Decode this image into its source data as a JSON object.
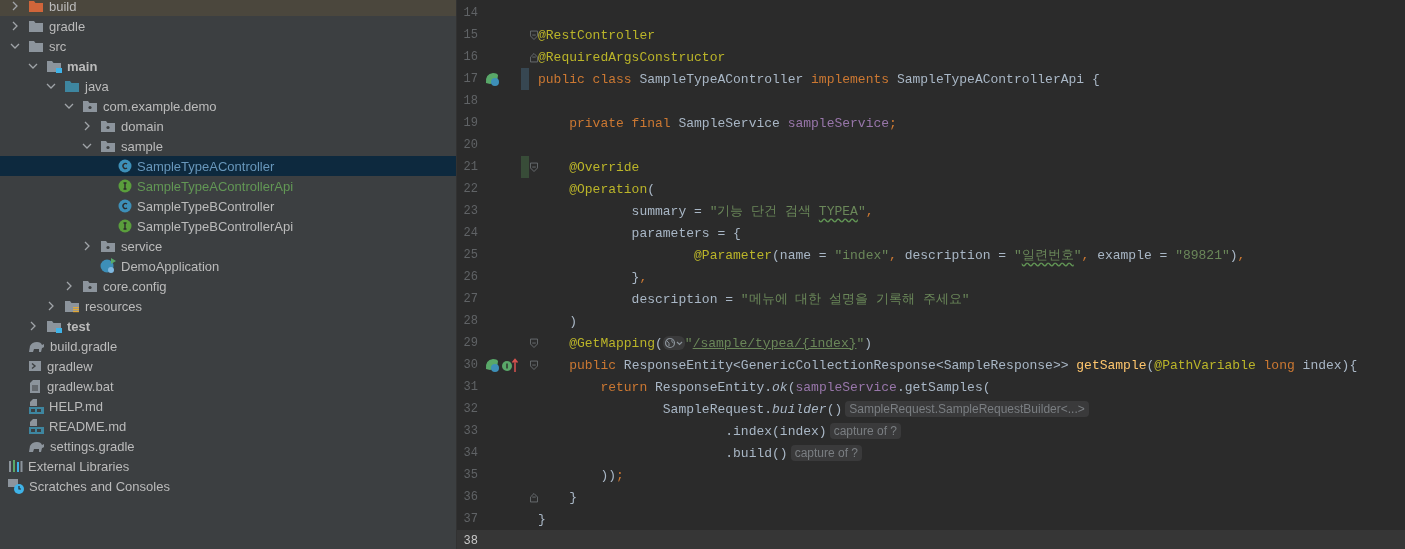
{
  "project_tree": [
    {
      "label": "build",
      "kind": "excluded-folder",
      "expanded": false,
      "selected": false,
      "modified": false,
      "added": false
    },
    {
      "label": "gradle",
      "kind": "folder",
      "expanded": false,
      "selected": false,
      "modified": false,
      "added": false
    },
    {
      "label": "src",
      "kind": "folder",
      "expanded": true,
      "selected": false,
      "modified": false,
      "added": false,
      "children": [
        {
          "label": "main",
          "kind": "module-folder",
          "expanded": true,
          "selected": false,
          "modified": false,
          "added": false,
          "children": [
            {
              "label": "java",
              "kind": "source-folder",
              "expanded": true,
              "selected": false,
              "modified": false,
              "added": false,
              "children": [
                {
                  "label": "com.example.demo",
                  "kind": "package",
                  "expanded": true,
                  "selected": false,
                  "modified": false,
                  "added": false,
                  "children": [
                    {
                      "label": "domain",
                      "kind": "package",
                      "expanded": false,
                      "selected": false,
                      "modified": false,
                      "added": false
                    },
                    {
                      "label": "sample",
                      "kind": "package",
                      "expanded": true,
                      "selected": false,
                      "modified": false,
                      "added": false,
                      "children": [
                        {
                          "label": "SampleTypeAController",
                          "kind": "class",
                          "selected": true,
                          "modified": true,
                          "added": false
                        },
                        {
                          "label": "SampleTypeAControllerApi",
                          "kind": "interface",
                          "selected": false,
                          "modified": false,
                          "added": true
                        },
                        {
                          "label": "SampleTypeBController",
                          "kind": "class",
                          "selected": false,
                          "modified": false,
                          "added": false
                        },
                        {
                          "label": "SampleTypeBControllerApi",
                          "kind": "interface",
                          "selected": false,
                          "modified": false,
                          "added": false
                        }
                      ]
                    },
                    {
                      "label": "service",
                      "kind": "package",
                      "expanded": false,
                      "selected": false,
                      "modified": false,
                      "added": false
                    },
                    {
                      "label": "DemoApplication",
                      "kind": "spring-app",
                      "selected": false,
                      "modified": false,
                      "added": false
                    }
                  ]
                },
                {
                  "label": "core.config",
                  "kind": "package",
                  "expanded": false,
                  "selected": false,
                  "modified": false,
                  "added": false
                }
              ]
            },
            {
              "label": "resources",
              "kind": "resources-folder",
              "expanded": false,
              "selected": false,
              "modified": false,
              "added": false
            }
          ]
        },
        {
          "label": "test",
          "kind": "module-folder",
          "expanded": false,
          "selected": false,
          "modified": false,
          "added": false
        }
      ]
    },
    {
      "label": "build.gradle",
      "kind": "gradle",
      "selected": false,
      "modified": false,
      "added": false
    },
    {
      "label": "gradlew",
      "kind": "script",
      "selected": false,
      "modified": false,
      "added": false
    },
    {
      "label": "gradlew.bat",
      "kind": "text",
      "selected": false,
      "modified": false,
      "added": false
    },
    {
      "label": "HELP.md",
      "kind": "markdown",
      "selected": false,
      "modified": false,
      "added": false
    },
    {
      "label": "README.md",
      "kind": "markdown",
      "selected": false,
      "modified": false,
      "added": false
    },
    {
      "label": "settings.gradle",
      "kind": "gradle",
      "selected": false,
      "modified": false,
      "added": false
    },
    {
      "label": "External Libraries",
      "kind": "libraries",
      "selected": false,
      "modified": false,
      "added": false
    },
    {
      "label": "Scratches and Consoles",
      "kind": "scratches",
      "selected": false,
      "modified": false,
      "added": false
    }
  ],
  "editor": {
    "lines": [
      {
        "number": "14",
        "current": false
      },
      {
        "number": "15",
        "current": false,
        "markers": [
          {
            "kind": "fold-start"
          }
        ],
        "tokens": [
          {
            "text": "@RestController",
            "kind": "ann"
          }
        ]
      },
      {
        "number": "16",
        "current": false,
        "markers": [
          {
            "kind": "fold-end"
          }
        ],
        "tokens": [
          {
            "text": "@RequiredArgsConstructor",
            "kind": "ann"
          }
        ]
      },
      {
        "number": "17",
        "current": false,
        "markers": [
          {
            "kind": "spring-bean"
          },
          {
            "kind": "change-modified"
          }
        ],
        "tokens": [
          {
            "text": "public class ",
            "kind": "kw"
          },
          {
            "text": "SampleTypeAController ",
            "kind": "plain"
          },
          {
            "text": "implements ",
            "kind": "kw"
          },
          {
            "text": "SampleTypeAControllerApi {",
            "kind": "plain"
          }
        ]
      },
      {
        "number": "18",
        "current": false
      },
      {
        "number": "19",
        "current": false,
        "tokens": [
          {
            "text": "    private final ",
            "kind": "kw"
          },
          {
            "text": "SampleService ",
            "kind": "plain"
          },
          {
            "text": "sampleService",
            "kind": "field"
          },
          {
            "text": ";",
            "kind": "kw"
          }
        ]
      },
      {
        "number": "20",
        "current": false
      },
      {
        "number": "21",
        "current": false,
        "markers": [
          {
            "kind": "change-added"
          },
          {
            "kind": "fold-start"
          }
        ],
        "tokens": [
          {
            "text": "    @Override",
            "kind": "ann"
          }
        ]
      },
      {
        "number": "22",
        "current": false,
        "tokens": [
          {
            "text": "    @Operation",
            "kind": "ann"
          },
          {
            "text": "(",
            "kind": "plain"
          }
        ]
      },
      {
        "number": "23",
        "current": false,
        "tokens": [
          {
            "text": "            summary = ",
            "kind": "plain"
          },
          {
            "text": "\"기능 단건 검색 ",
            "kind": "str"
          },
          {
            "text": "TYPEA",
            "kind": "str-typo"
          },
          {
            "text": "\"",
            "kind": "str"
          },
          {
            "text": ",",
            "kind": "kw"
          }
        ]
      },
      {
        "number": "24",
        "current": false,
        "tokens": [
          {
            "text": "            parameters = {",
            "kind": "plain"
          }
        ]
      },
      {
        "number": "25",
        "current": false,
        "tokens": [
          {
            "text": "                    @Parameter",
            "kind": "ann"
          },
          {
            "text": "(name = ",
            "kind": "plain"
          },
          {
            "text": "\"index\"",
            "kind": "str"
          },
          {
            "text": ", ",
            "kind": "kw"
          },
          {
            "text": "description = ",
            "kind": "plain"
          },
          {
            "text": "\"",
            "kind": "str"
          },
          {
            "text": "일련번호",
            "kind": "str-typo"
          },
          {
            "text": "\"",
            "kind": "str"
          },
          {
            "text": ", ",
            "kind": "kw"
          },
          {
            "text": "example = ",
            "kind": "plain"
          },
          {
            "text": "\"89821\"",
            "kind": "str"
          },
          {
            "text": ")",
            "kind": "plain"
          },
          {
            "text": ",",
            "kind": "kw"
          }
        ]
      },
      {
        "number": "26",
        "current": false,
        "tokens": [
          {
            "text": "            }",
            "kind": "plain"
          },
          {
            "text": ",",
            "kind": "kw"
          }
        ]
      },
      {
        "number": "27",
        "current": false,
        "tokens": [
          {
            "text": "            description = ",
            "kind": "plain"
          },
          {
            "text": "\"메뉴에 대한 설명을 기록해 주세요\"",
            "kind": "str"
          }
        ]
      },
      {
        "number": "28",
        "current": false,
        "tokens": [
          {
            "text": "    )",
            "kind": "plain"
          }
        ]
      },
      {
        "number": "29",
        "current": false,
        "markers": [
          {
            "kind": "fold-start"
          }
        ],
        "tokens": [
          {
            "text": "    @GetMapping",
            "kind": "ann"
          },
          {
            "text": "(",
            "kind": "plain"
          },
          {
            "kind": "url-icon"
          },
          {
            "text": "\"",
            "kind": "str"
          },
          {
            "text": "/sample/typea/{index}",
            "kind": "link"
          },
          {
            "text": "\"",
            "kind": "str"
          },
          {
            "text": ")",
            "kind": "plain"
          }
        ]
      },
      {
        "number": "30",
        "current": false,
        "markers": [
          {
            "kind": "spring-bean"
          },
          {
            "kind": "implements"
          },
          {
            "kind": "fold-start"
          }
        ],
        "tokens": [
          {
            "text": "    public ",
            "kind": "kw"
          },
          {
            "text": "ResponseEntity<GenericCollectionResponse<SampleResponse>> ",
            "kind": "plain"
          },
          {
            "text": "getSample",
            "kind": "fn"
          },
          {
            "text": "(",
            "kind": "plain"
          },
          {
            "text": "@PathVariable",
            "kind": "ann"
          },
          {
            "text": " long ",
            "kind": "kw"
          },
          {
            "text": "index){",
            "kind": "plain"
          }
        ]
      },
      {
        "number": "31",
        "current": false,
        "tokens": [
          {
            "text": "        return ",
            "kind": "kw"
          },
          {
            "text": "ResponseEntity.",
            "kind": "plain"
          },
          {
            "text": "ok",
            "kind": "italic"
          },
          {
            "text": "(",
            "kind": "plain"
          },
          {
            "text": "sampleService",
            "kind": "field"
          },
          {
            "text": ".getSamples(",
            "kind": "plain"
          }
        ]
      },
      {
        "number": "32",
        "current": false,
        "tokens": [
          {
            "text": "                SampleRequest.",
            "kind": "plain"
          },
          {
            "text": "builder",
            "kind": "italic"
          },
          {
            "text": "()",
            "kind": "plain"
          },
          {
            "text": "SampleRequest.SampleRequestBuilder<...>",
            "kind": "hint"
          }
        ]
      },
      {
        "number": "33",
        "current": false,
        "tokens": [
          {
            "text": "                        .index(index)",
            "kind": "plain"
          },
          {
            "text": "capture of ?",
            "kind": "hint"
          }
        ]
      },
      {
        "number": "34",
        "current": false,
        "tokens": [
          {
            "text": "                        .build()",
            "kind": "plain"
          },
          {
            "text": "capture of ?",
            "kind": "hint"
          }
        ]
      },
      {
        "number": "35",
        "current": false,
        "tokens": [
          {
            "text": "        ))",
            "kind": "plain"
          },
          {
            "text": ";",
            "kind": "kw"
          }
        ]
      },
      {
        "number": "36",
        "current": false,
        "markers": [
          {
            "kind": "fold-end"
          }
        ],
        "tokens": [
          {
            "text": "    }",
            "kind": "plain"
          }
        ]
      },
      {
        "number": "37",
        "current": false,
        "tokens": [
          {
            "text": "}",
            "kind": "plain"
          }
        ]
      },
      {
        "number": "38",
        "current": true
      }
    ]
  }
}
